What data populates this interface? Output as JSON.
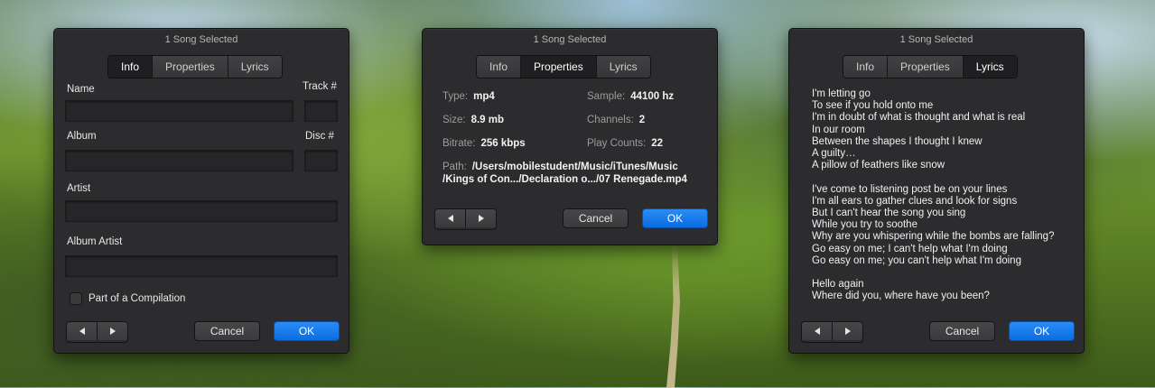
{
  "panels": {
    "info": {
      "title": "1 Song Selected",
      "tabs": [
        "Info",
        "Properties",
        "Lyrics"
      ],
      "active_tab": "Info",
      "labels": {
        "name": "Name",
        "track": "Track #",
        "album": "Album",
        "disc": "Disc #",
        "artist": "Artist",
        "album_artist": "Album Artist",
        "compilation": "Part of a Compilation"
      },
      "fields": {
        "name": "",
        "track": "",
        "album": "",
        "disc": "",
        "artist": "",
        "album_artist": ""
      },
      "compilation_checked": false,
      "cancel_label": "Cancel",
      "ok_label": "OK"
    },
    "properties": {
      "title": "1 Song Selected",
      "tabs": [
        "Info",
        "Properties",
        "Lyrics"
      ],
      "active_tab": "Properties",
      "items": {
        "type_k": "Type:",
        "type_v": "mp4",
        "sample_k": "Sample:",
        "sample_v": "44100 hz",
        "size_k": "Size:",
        "size_v": "8.9 mb",
        "channels_k": "Channels:",
        "channels_v": "2",
        "bitrate_k": "Bitrate:",
        "bitrate_v": "256 kbps",
        "playcount_k": "Play Counts:",
        "playcount_v": "22",
        "path_k": "Path:",
        "path_v1": "/Users/mobilestudent/Music/iTunes/Music",
        "path_v2": "/Kings of Con.../Declaration o.../07 Renegade.mp4"
      },
      "cancel_label": "Cancel",
      "ok_label": "OK"
    },
    "lyrics": {
      "title": "1 Song Selected",
      "tabs": [
        "Info",
        "Properties",
        "Lyrics"
      ],
      "active_tab": "Lyrics",
      "lines": [
        "I'm letting go",
        "To see if you hold onto me",
        "I'm in doubt of what is thought and what is real",
        "In our room",
        "Between the shapes I thought I knew",
        "A guilty…",
        "A pillow of feathers like snow",
        "",
        "I've come to listening post be on your lines",
        "I'm all ears to gather clues and look for signs",
        "But I can't hear the song you sing",
        "While you try to soothe",
        "Why are you whispering while the bombs are falling?",
        "Go easy on me; I can't help what I'm doing",
        "Go easy on me; you can't help what I'm doing",
        "",
        "Hello again",
        "Where did you, where have you been?"
      ],
      "cancel_label": "Cancel",
      "ok_label": "OK"
    }
  },
  "colors": {
    "panel_bg": "#2c2c2e",
    "accent_ok": "#0b6ce0",
    "active_tab_bg": "#1f1f21"
  }
}
